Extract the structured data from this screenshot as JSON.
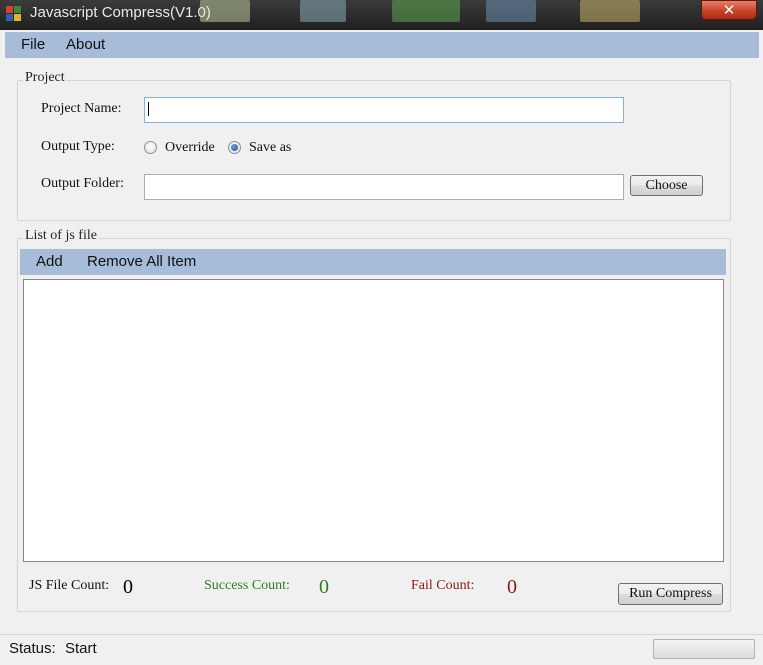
{
  "window": {
    "title": "Javascript Compress(V1.0)",
    "close_glyph": "✕"
  },
  "menu": {
    "file": "File",
    "about": "About"
  },
  "project": {
    "legend": "Project",
    "name_label": "Project Name:",
    "name_value": "",
    "output_type_label": "Output Type:",
    "override_label": "Override",
    "saveas_label": "Save as",
    "selected_output": "Save as",
    "folder_label": "Output Folder:",
    "folder_value": "",
    "choose_label": "Choose"
  },
  "js_list": {
    "legend": "List of js file",
    "add_label": "Add",
    "remove_all_label": "Remove All Item",
    "items": []
  },
  "counts": {
    "js_label": "JS File Count:",
    "js_value": "0",
    "success_label": "Success Count:",
    "success_value": "0",
    "fail_label": "Fail Count:",
    "fail_value": "0",
    "run_label": "Run Compress",
    "success_color": "#2e7d1e",
    "fail_color": "#8a1a1a"
  },
  "status": {
    "label": "Status:",
    "value": "Start",
    "progress": 0
  },
  "colors": {
    "menubar": "#a6bcd8",
    "window_bg": "#f0f0f0"
  }
}
